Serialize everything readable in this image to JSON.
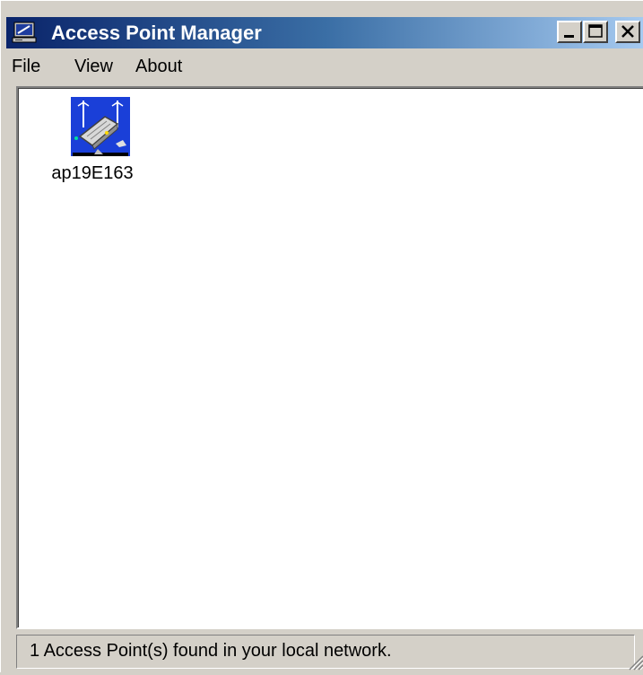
{
  "window": {
    "title": "Access Point Manager",
    "title_icon": "network-computer-icon",
    "controls": {
      "minimize": "minimize-icon",
      "maximize": "maximize-icon",
      "close": "close-icon"
    }
  },
  "menubar": {
    "items": [
      {
        "label": "File"
      },
      {
        "label": "View"
      },
      {
        "label": "About"
      }
    ]
  },
  "content": {
    "items": [
      {
        "label": "ap19E163",
        "icon": "access-point-icon"
      }
    ]
  },
  "statusbar": {
    "text": "1 Access Point(s) found in your local network."
  },
  "colors": {
    "titlebar_start": "#0a246a",
    "titlebar_end": "#a6caf0",
    "window_face": "#d4d0c8",
    "content_bg": "#ffffff"
  }
}
